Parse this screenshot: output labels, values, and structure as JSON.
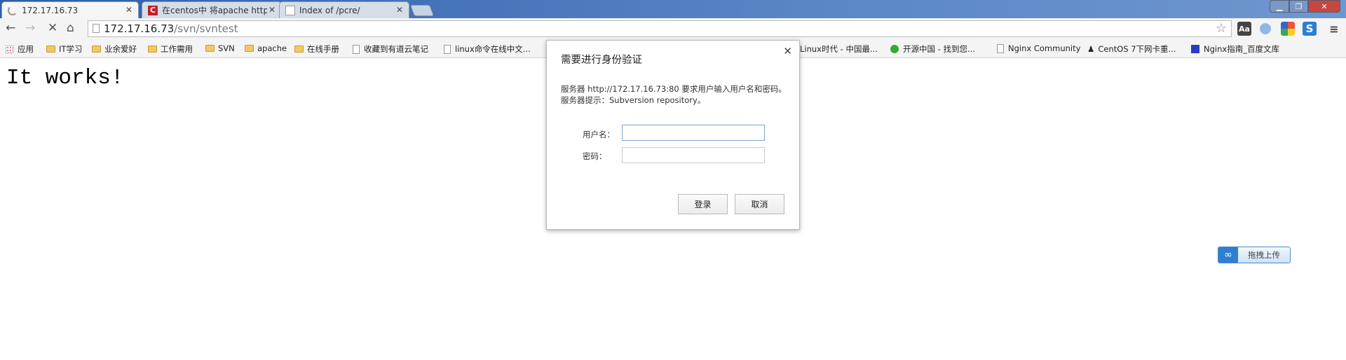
{
  "tabs": [
    {
      "title": "172.17.16.73",
      "icon": "loading-icon",
      "active": true
    },
    {
      "title": "在centos中 将apache http",
      "icon": "csdn-icon",
      "active": false
    },
    {
      "title": "Index of /pcre/",
      "icon": "page-icon",
      "active": false
    }
  ],
  "toolbar": {
    "url_host": "172.17.16.73",
    "url_path": "/svn/svntest",
    "ext_dict": "Aa"
  },
  "bookmarks": [
    {
      "label": "应用",
      "icon": "apps-icon"
    },
    {
      "label": "IT学习",
      "icon": "folder-icon"
    },
    {
      "label": "业余爱好",
      "icon": "folder-icon"
    },
    {
      "label": "工作需用",
      "icon": "folder-icon"
    },
    {
      "label": "SVN",
      "icon": "folder-icon"
    },
    {
      "label": "apache",
      "icon": "folder-icon"
    },
    {
      "label": "在线手册",
      "icon": "folder-icon"
    },
    {
      "label": "收藏到有道云笔记",
      "icon": "page-icon"
    },
    {
      "label": "linux命令在线中文...",
      "icon": "page-icon"
    },
    {
      "label": "Linux时代 - 中国最...",
      "icon": "none"
    },
    {
      "label": "开源中国 - 找到您...",
      "icon": "oschina-icon"
    },
    {
      "label": "Nginx Community",
      "icon": "page-icon"
    },
    {
      "label": "CentOS 7下网卡重...",
      "icon": "penguin-icon"
    },
    {
      "label": "Nginx指南_百度文库",
      "icon": "baidu-icon"
    }
  ],
  "page": {
    "text": "It works!"
  },
  "dialog": {
    "title": "需要进行身份验证",
    "message_line1": "服务器 http://172.17.16.73:80 要求用户输入用户名和密码。",
    "message_line2": "服务器提示：Subversion repository。",
    "username_label": "用户名：",
    "username_value": "",
    "password_label": "密码：",
    "password_value": "",
    "login_label": "登录",
    "cancel_label": "取消"
  },
  "upload_button": {
    "label": "拖拽上传"
  }
}
